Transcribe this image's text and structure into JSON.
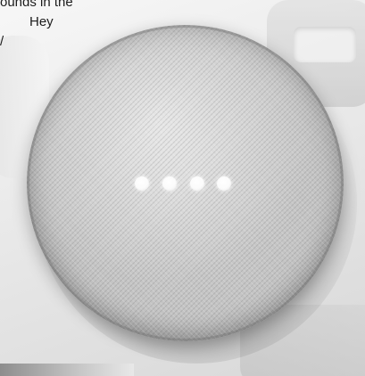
{
  "caption": {
    "line1": "ounds in the",
    "line2": "Hey",
    "line3": "/"
  },
  "speaker": {
    "led_count": 4,
    "colors": {
      "fabric": "#c3c3c3",
      "led": "#ffffff"
    }
  }
}
